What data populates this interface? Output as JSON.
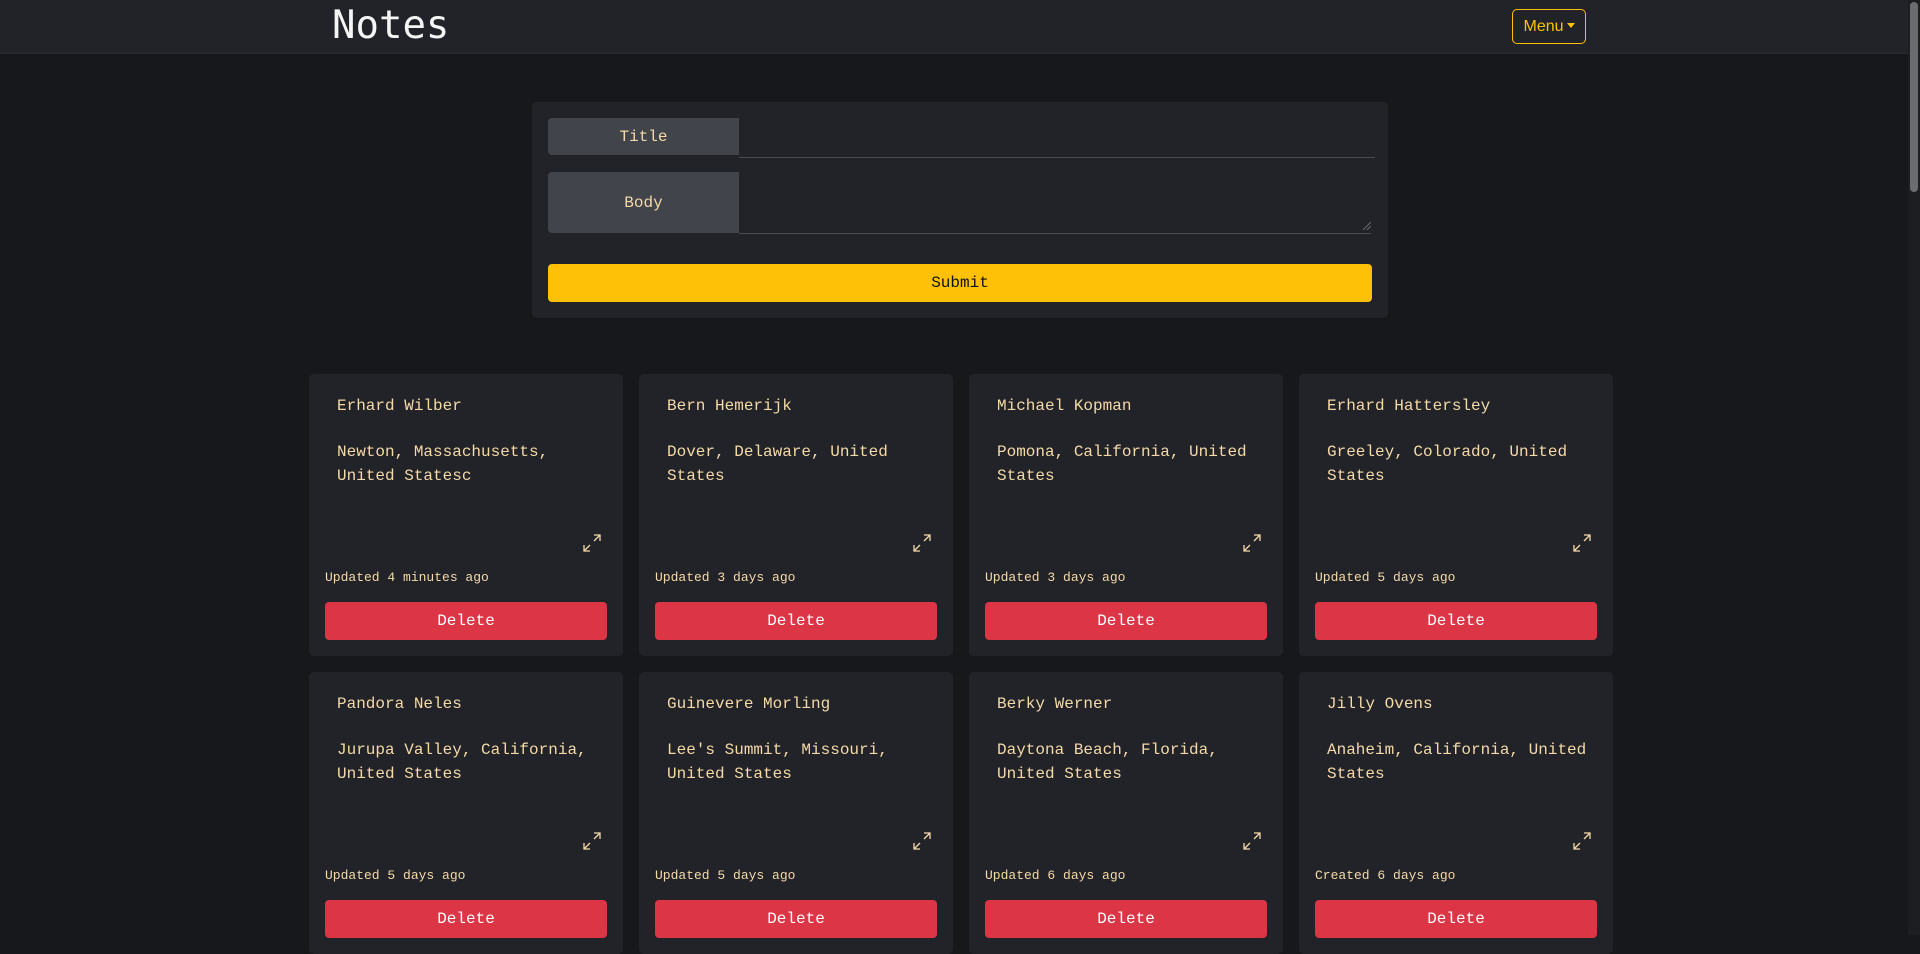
{
  "app": {
    "title": "Notes",
    "menu_label": "Menu"
  },
  "form": {
    "title_label": "Title",
    "title_value": "",
    "body_label": "Body",
    "body_value": "",
    "submit_label": "Submit"
  },
  "notes": [
    {
      "title": "Erhard Wilber",
      "body": "Newton, Massachusetts, United Statesc",
      "meta": "Updated 4 minutes ago",
      "delete_label": "Delete"
    },
    {
      "title": "Bern Hemerijk",
      "body": "Dover, Delaware, United States",
      "meta": "Updated 3 days ago",
      "delete_label": "Delete"
    },
    {
      "title": "Michael Kopman",
      "body": "Pomona, California, United States",
      "meta": "Updated 3 days ago",
      "delete_label": "Delete"
    },
    {
      "title": "Erhard Hattersley",
      "body": "Greeley, Colorado, United States",
      "meta": "Updated 5 days ago",
      "delete_label": "Delete"
    },
    {
      "title": "Pandora Neles",
      "body": "Jurupa Valley, California, United States",
      "meta": "Updated 5 days ago",
      "delete_label": "Delete"
    },
    {
      "title": "Guinevere Morling",
      "body": "Lee's Summit, Missouri, United States",
      "meta": "Updated 5 days ago",
      "delete_label": "Delete"
    },
    {
      "title": "Berky Werner",
      "body": "Daytona Beach, Florida, United States",
      "meta": "Updated 6 days ago",
      "delete_label": "Delete"
    },
    {
      "title": "Jilly Ovens",
      "body": "Anaheim, California, United States",
      "meta": "Created 6 days ago",
      "delete_label": "Delete"
    }
  ],
  "colors": {
    "accent": "#ffc107",
    "danger": "#dc3545",
    "text": "#f5d9a8",
    "background": "#17181c",
    "card": "#212328"
  },
  "icons": {
    "expand": "expand-icon",
    "menu_caret": "chevron-down-icon"
  }
}
